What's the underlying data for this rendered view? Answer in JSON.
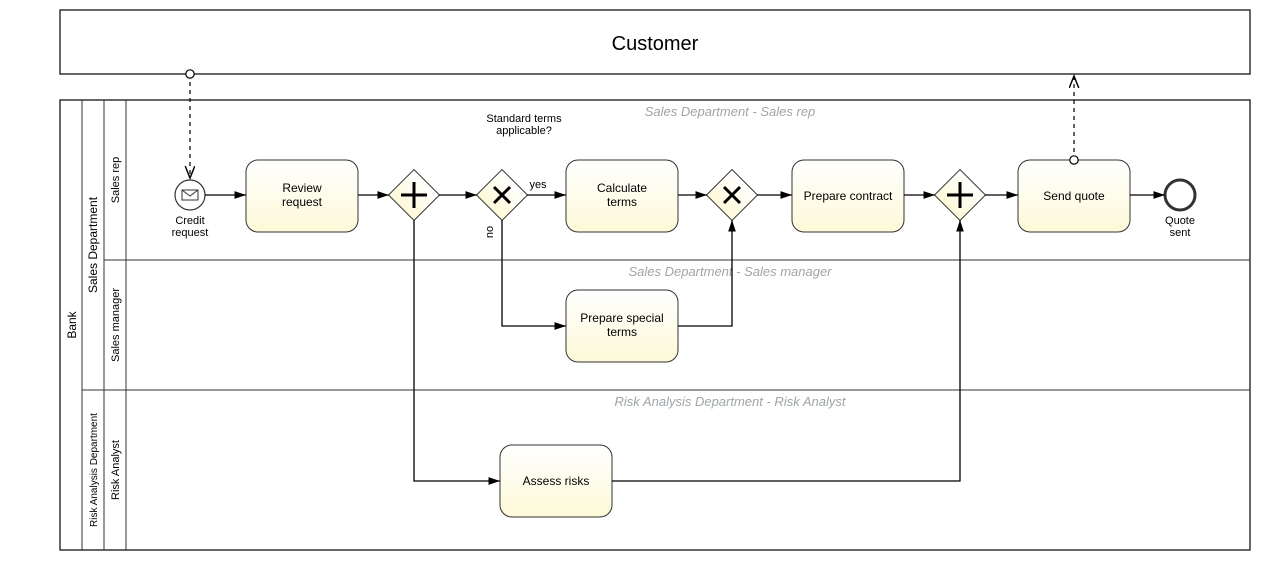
{
  "pools": {
    "customer": {
      "name": "Customer"
    },
    "bank": {
      "name": "Bank",
      "subpools": {
        "sales": {
          "name": "Sales Department",
          "lanes": {
            "rep": {
              "name": "Sales rep",
              "watermark": "Sales Department - Sales rep"
            },
            "mgr": {
              "name": "Sales manager",
              "watermark": "Sales Department - Sales manager"
            }
          }
        },
        "risk": {
          "name": "Risk Analysis Department",
          "lanes": {
            "analyst": {
              "name": "Risk Analyst",
              "watermark": "Risk Analysis Department - Risk Analyst"
            }
          }
        }
      }
    }
  },
  "events": {
    "start": {
      "label1": "Credit",
      "label2": "request"
    },
    "end": {
      "label1": "Quote",
      "label2": "sent"
    }
  },
  "tasks": {
    "review": {
      "line1": "Review",
      "line2": "request"
    },
    "calc": {
      "line1": "Calculate",
      "line2": "terms"
    },
    "contract": {
      "line1": "Prepare contract"
    },
    "send": {
      "line1": "Send quote"
    },
    "special": {
      "line1": "Prepare special",
      "line2": "terms"
    },
    "assess": {
      "line1": "Assess risks"
    }
  },
  "gateways": {
    "split_parallel": {
      "type": "parallel"
    },
    "terms_decision": {
      "type": "exclusive",
      "label1": "Standard terms",
      "label2": "applicable?",
      "yes": "yes",
      "no": "no"
    },
    "terms_merge": {
      "type": "exclusive"
    },
    "join_parallel": {
      "type": "parallel"
    }
  }
}
